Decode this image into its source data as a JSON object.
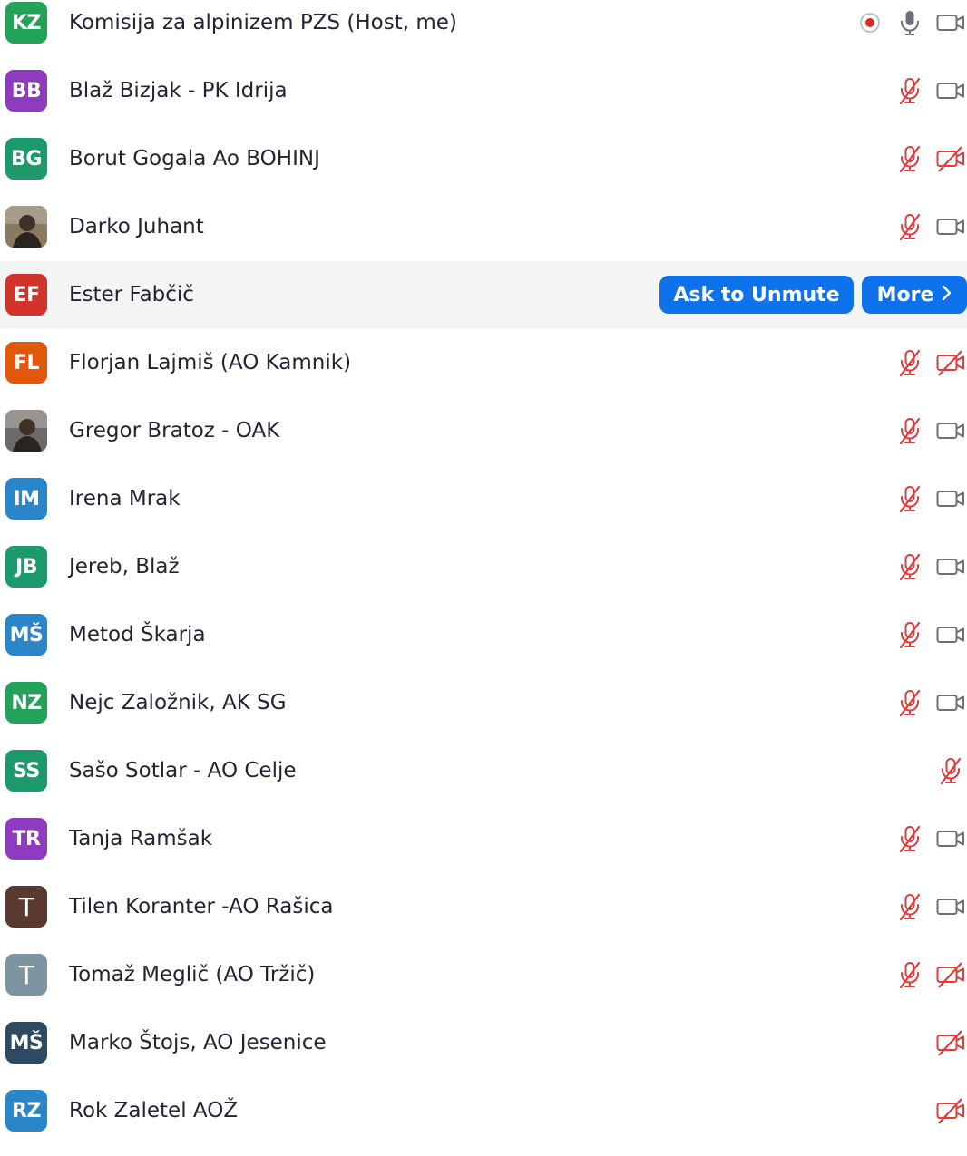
{
  "colors": {
    "muted_red": "#e03d3d",
    "icon_gray": "#6e6e7e",
    "button_blue": "#0e72ed",
    "record_red": "#e02828",
    "hover_bg": "#f4f4f4"
  },
  "row_actions": {
    "ask_to_unmute": "Ask to Unmute",
    "more": "More"
  },
  "participants": [
    {
      "initials": "KZ",
      "name": "Komisija za alpinizem PZS (Host, me)",
      "avatar_color": "#23a35a",
      "mic": "on",
      "video": "on",
      "recording": true
    },
    {
      "initials": "BB",
      "name": "Blaž Bizjak - PK Idrija",
      "avatar_color": "#8f3bbd",
      "mic": "muted",
      "video": "on"
    },
    {
      "initials": "BG",
      "name": "Borut Gogala Ao BOHINJ",
      "avatar_color": "#1d9a6c",
      "mic": "muted",
      "video": "off"
    },
    {
      "initials": "",
      "name": "Darko Juhant",
      "avatar_icon": "photo-avatar",
      "avatar_color": "#8a7a60",
      "mic": "muted",
      "video": "on"
    },
    {
      "initials": "EF",
      "name": "Ester Fabčič",
      "avatar_color": "#d0352b",
      "hovered": true
    },
    {
      "initials": "FL",
      "name": "Florjan Lajmiš (AO Kamnik)",
      "avatar_color": "#e1580c",
      "mic": "muted",
      "video": "off"
    },
    {
      "initials": "",
      "name": "Gregor Bratoz - OAK",
      "avatar_icon": "photo-avatar",
      "avatar_color": "#6a6a6a",
      "mic": "muted",
      "video": "on"
    },
    {
      "initials": "IM",
      "name": "Irena Mrak",
      "avatar_color": "#2a86c9",
      "mic": "muted",
      "video": "on"
    },
    {
      "initials": "JB",
      "name": "Jereb, Blaž",
      "avatar_color": "#1d9a6c",
      "mic": "muted",
      "video": "on"
    },
    {
      "initials": "MŠ",
      "name": "Metod Škarja",
      "avatar_color": "#2a86c9",
      "mic": "muted",
      "video": "on"
    },
    {
      "initials": "NZ",
      "name": "Nejc Založnik, AK SG",
      "avatar_color": "#23a35a",
      "mic": "muted",
      "video": "on"
    },
    {
      "initials": "SS",
      "name": "Sašo Sotlar - AO Celje",
      "avatar_color": "#1d9a6c",
      "mic": "muted",
      "video": "none"
    },
    {
      "initials": "TR",
      "name": "Tanja Ramšak",
      "avatar_color": "#8f3bbd",
      "mic": "muted",
      "video": "on"
    },
    {
      "initials": "T",
      "name": "Tilen Koranter -AO Rašica",
      "avatar_color": "#5a3a30",
      "mic": "muted",
      "video": "on"
    },
    {
      "initials": "T",
      "name": "Tomaž Meglič (AO Tržič)",
      "avatar_color": "#7d95a0",
      "mic": "muted",
      "video": "off"
    },
    {
      "initials": "MŠ",
      "name": "Marko Štojs, AO Jesenice",
      "avatar_color": "#2e4a63",
      "mic": "none",
      "video": "off"
    },
    {
      "initials": "RZ",
      "name": "Rok Zaletel AOŽ",
      "avatar_color": "#2a86c9",
      "mic": "none",
      "video": "off"
    }
  ]
}
